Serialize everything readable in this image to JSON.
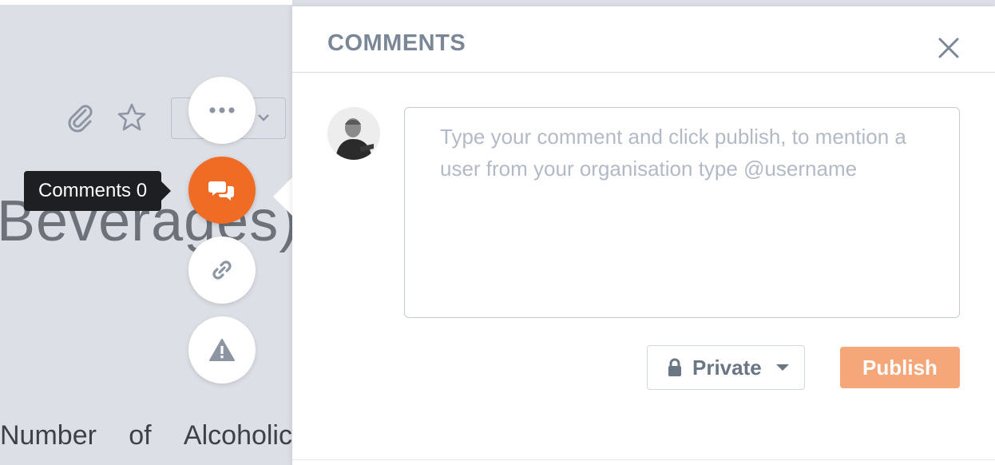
{
  "background": {
    "title_fragment": "Beverages)",
    "paragraph_words": [
      "Number",
      "of",
      "Alcoholic"
    ]
  },
  "actions": {
    "more": {
      "icon": "more-icon"
    },
    "comments": {
      "icon": "comments-icon",
      "tooltip": "Comments 0"
    },
    "link": {
      "icon": "link-icon"
    },
    "report": {
      "icon": "warning-icon"
    }
  },
  "comments_panel": {
    "title": "COMMENTS",
    "comment_placeholder": "Type your comment and click publish, to mention a user from your organisation type @username",
    "privacy": {
      "label": "Private",
      "icon": "lock-icon"
    },
    "publish_label": "Publish"
  },
  "colors": {
    "accent_orange": "#f06b24",
    "publish_disabled": "#f5a77a",
    "panel_title": "#7b8797"
  }
}
